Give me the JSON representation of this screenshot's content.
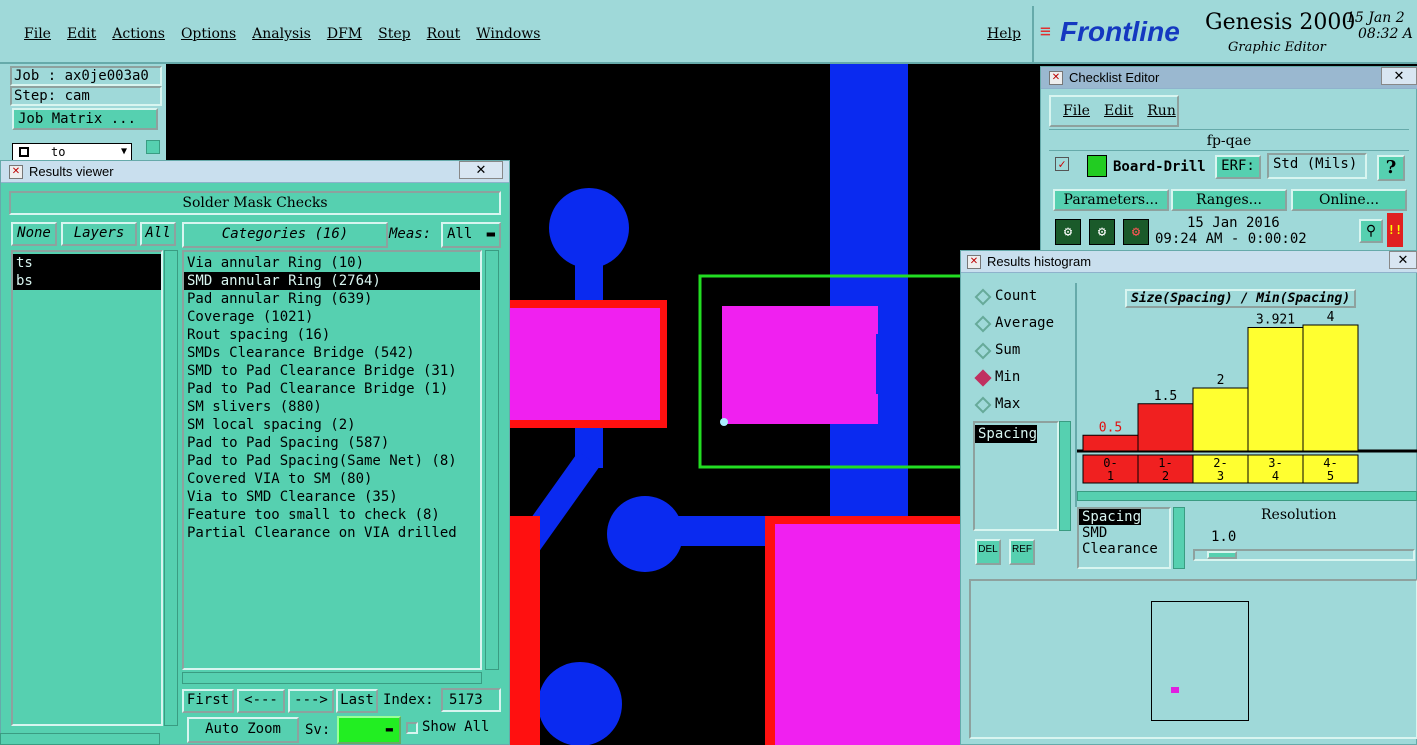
{
  "menubar": {
    "items": [
      "File",
      "Edit",
      "Actions",
      "Options",
      "Analysis",
      "DFM",
      "Step",
      "Rout",
      "Windows"
    ],
    "help": "Help"
  },
  "brand": {
    "logo": "Frontline",
    "product": "Genesis 2000",
    "subtitle": "Graphic Editor",
    "date": "15 Jan 2",
    "time": "08:32 A"
  },
  "job_panel": {
    "job": "Job : ax0je003a0",
    "step": "Step: cam",
    "job_matrix": "Job Matrix ...",
    "dropdown_value": "to"
  },
  "results_viewer": {
    "title": "Results viewer",
    "header": "Solder Mask Checks",
    "layer_tabs": {
      "none": "None",
      "layers": "Layers",
      "all": "All"
    },
    "categories_label": "Categories (16)",
    "meas_label": "Meas:",
    "meas_value": "All",
    "layers": [
      "ts",
      "bs"
    ],
    "categories": [
      "Via annular Ring (10)",
      "SMD annular Ring (2764)",
      "Pad annular Ring (639)",
      "Coverage (1021)",
      "Rout spacing (16)",
      "SMDs Clearance Bridge (542)",
      "SMD to Pad Clearance Bridge (31)",
      "Pad to Pad Clearance Bridge (1)",
      "SM slivers (880)",
      "SM local spacing (2)",
      "Pad to Pad Spacing (587)",
      "Pad to Pad Spacing(Same Net) (8)",
      "Covered VIA to SM (80)",
      "Via to SMD Clearance (35)",
      "Feature too small to check (8)",
      "Partial Clearance on VIA drilled"
    ],
    "selected_category_index": 1,
    "nav": {
      "first": "First",
      "prev": "<---",
      "next": "--->",
      "last": "Last",
      "index_label": "Index:",
      "index_value": "5173"
    },
    "auto_zoom": "Auto Zoom",
    "sv_label": "Sv:",
    "show_all": "Show All"
  },
  "checklist_editor": {
    "title": "Checklist Editor",
    "menu": [
      "File",
      "Edit",
      "Run"
    ],
    "name": "fp-qae",
    "item": "Board-Drill Che",
    "erf_label": "ERF:",
    "erf_value": "Std (Mils)",
    "help": "?",
    "buttons": [
      "Parameters...",
      "Ranges...",
      "Online..."
    ],
    "run_date": "15 Jan 2016",
    "run_time": "09:24 AM - 0:00:02",
    "alert": "!!"
  },
  "histogram": {
    "title": "Results histogram",
    "modes": [
      "Count",
      "Average",
      "Sum",
      "Min",
      "Max"
    ],
    "selected_mode": "Min",
    "left_list": [
      "Spacing"
    ],
    "chart_title": "Size(Spacing) / Min(Spacing)",
    "bins": [
      "0-\n1",
      "1-\n2",
      "2-\n3",
      "3-\n4",
      "4-\n5"
    ],
    "bin_top": [
      "0-",
      "1-",
      "2-",
      "3-",
      "4-"
    ],
    "bin_bottom": [
      "1",
      "2",
      "3",
      "4",
      "5"
    ],
    "values": [
      0.5,
      1.5,
      2,
      3.921,
      4
    ],
    "value_labels": [
      "0.5",
      "1.5",
      "2",
      "3.921",
      "4"
    ],
    "bar_colors": [
      "#f02020",
      "#f02020",
      "#ffff30",
      "#ffff30",
      "#ffff30"
    ],
    "right_list": [
      "Spacing",
      "SMD",
      "Clearance"
    ],
    "resolution_label": "Resolution",
    "resolution_value": "1.0",
    "del": "DEL",
    "ref": "REF"
  },
  "colors": {
    "panel": "#56d0b0",
    "bar": "#9fd9d9",
    "blue_trace": "#0a2af0",
    "magenta_pad": "#f020f0",
    "red_outline": "#ff1010",
    "select_box": "#22dd22"
  }
}
